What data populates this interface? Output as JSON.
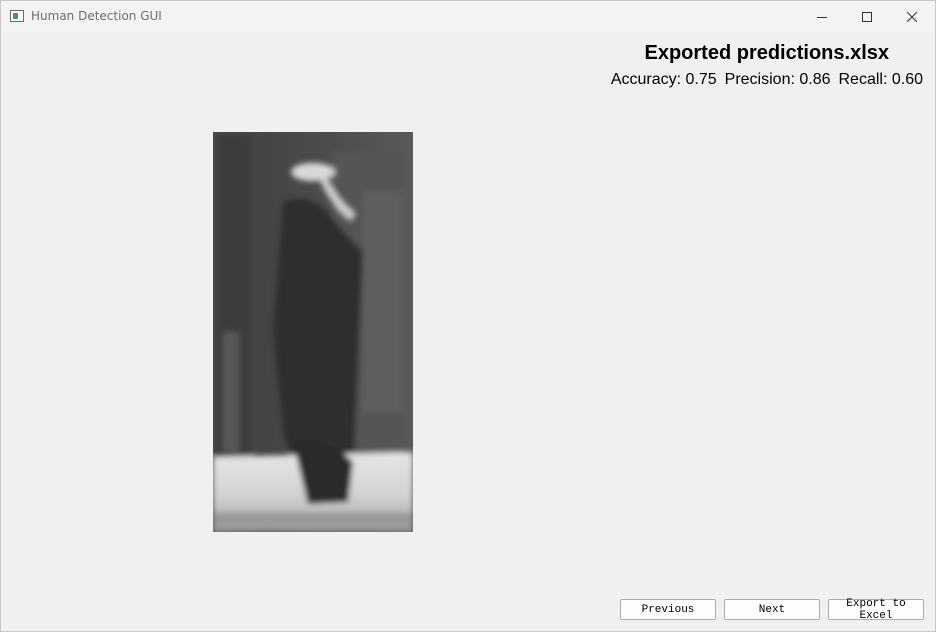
{
  "window": {
    "title": "Human Detection GUI",
    "controls": {
      "minimize": "minimize-icon",
      "maximize": "maximize-icon",
      "close": "close-icon"
    }
  },
  "status": {
    "heading": "Exported predictions.xlsx",
    "accuracy": "Accuracy: 0.75",
    "precision": "Precision: 0.86",
    "recall": "Recall: 0.60"
  },
  "preview": {
    "description_icon": "grayscale-pedestrian-image"
  },
  "buttons": {
    "previous": "Previous",
    "next": "Next",
    "export": "Export to Excel"
  }
}
